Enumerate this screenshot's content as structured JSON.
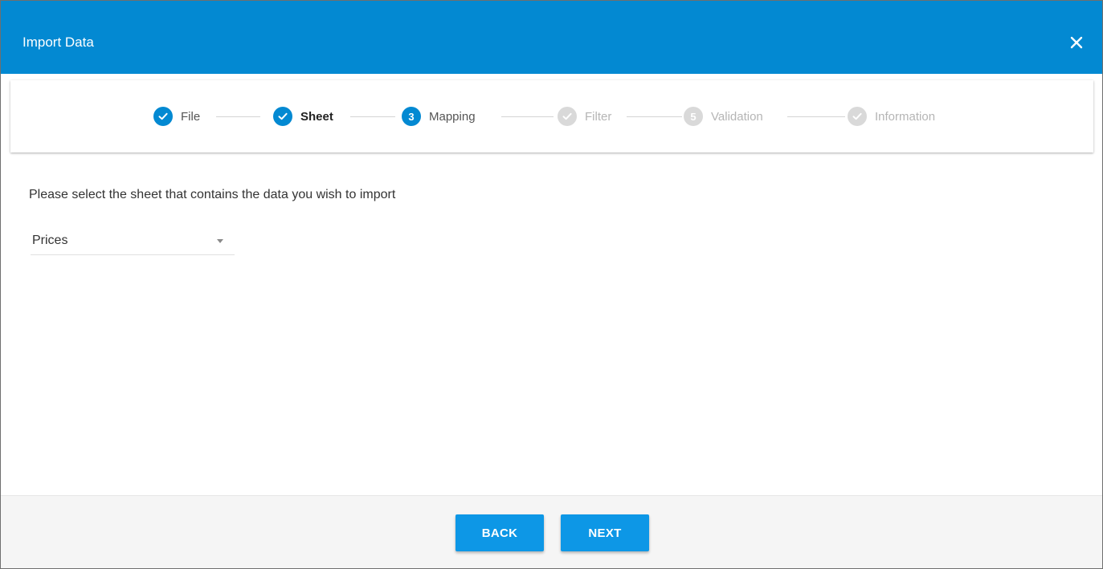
{
  "dialog": {
    "title": "Import Data",
    "close_icon": "close-icon"
  },
  "colors": {
    "header_bg": "#0389d2",
    "step_active": "#0389d2",
    "step_inactive": "#d9d9d9",
    "button_bg": "#0d97e6",
    "footer_bg": "#f5f5f5"
  },
  "stepper": {
    "steps": [
      {
        "label": "File",
        "state": "completed",
        "icon": "check-icon"
      },
      {
        "label": "Sheet",
        "state": "completed-current",
        "icon": "check-icon"
      },
      {
        "label": "Mapping",
        "state": "active",
        "number": "3"
      },
      {
        "label": "Filter",
        "state": "pending",
        "icon": "check-icon"
      },
      {
        "label": "Validation",
        "state": "pending",
        "number": "5"
      },
      {
        "label": "Information",
        "state": "pending",
        "icon": "check-icon"
      }
    ]
  },
  "content": {
    "instruction": "Please select the sheet that contains the data you wish to import",
    "sheet_select": {
      "value": "Prices",
      "icon": "dropdown-arrow-icon"
    }
  },
  "footer": {
    "back_label": "BACK",
    "next_label": "NEXT"
  }
}
